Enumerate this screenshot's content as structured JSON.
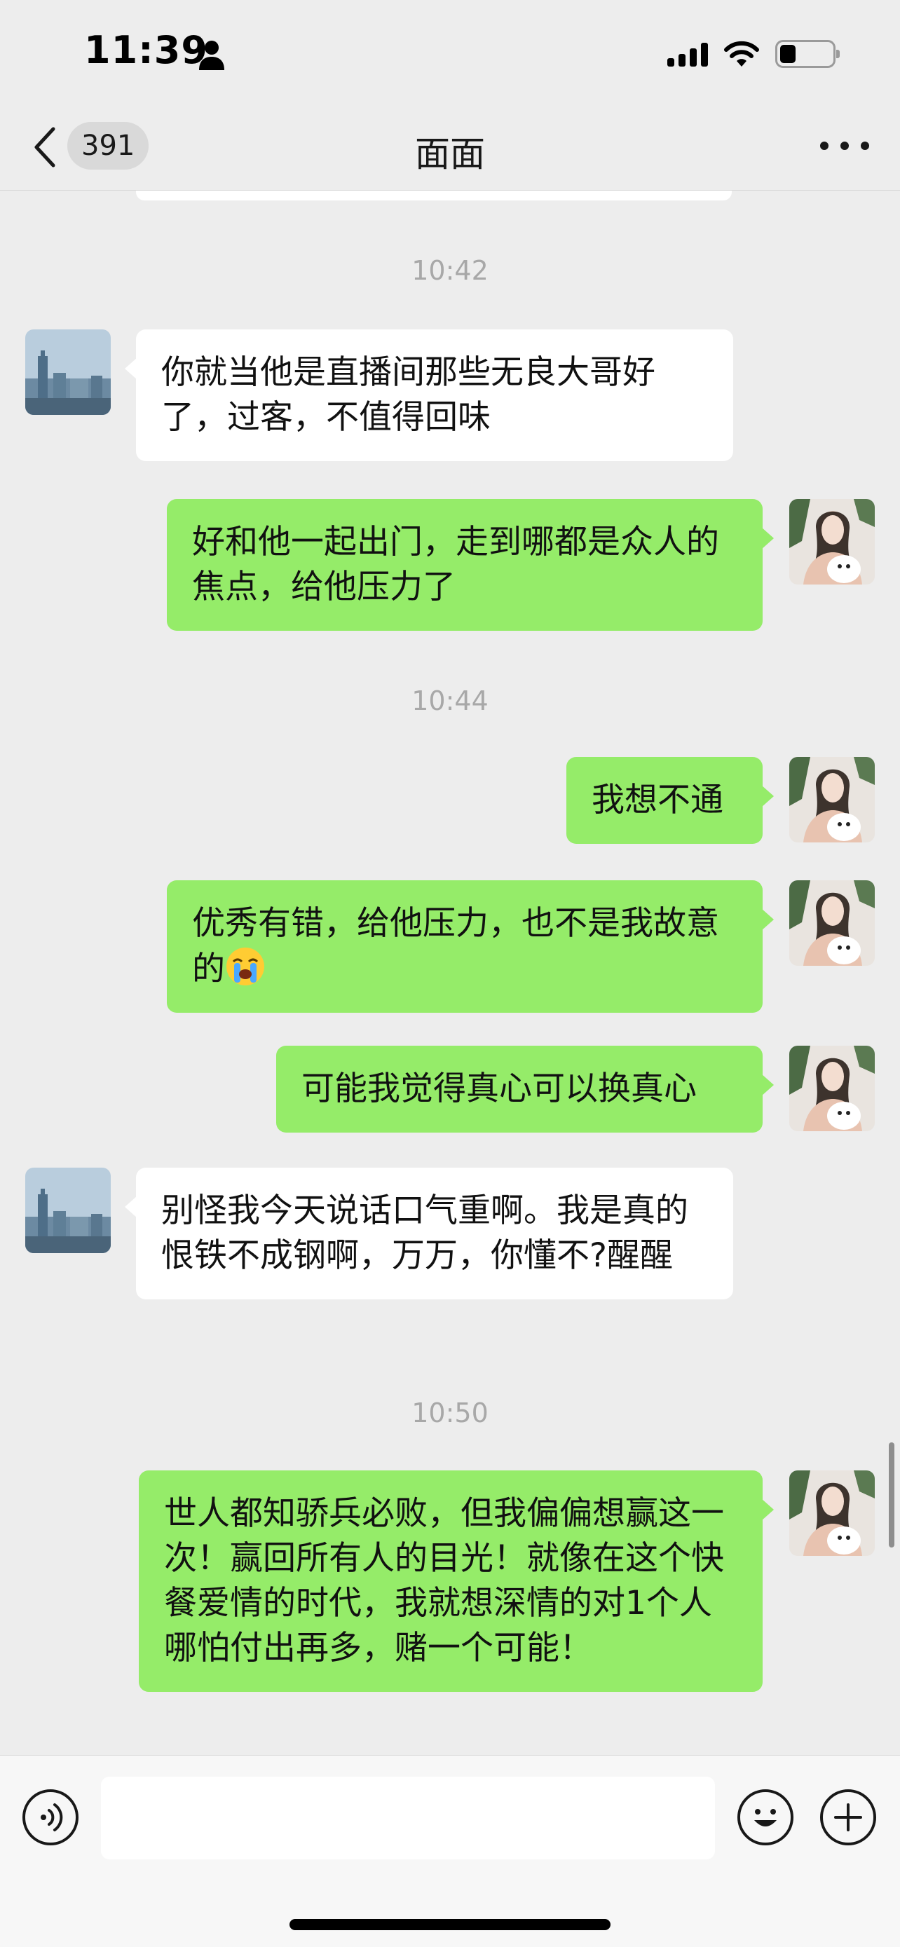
{
  "status_bar": {
    "time": "11:39",
    "person_icon": "person-icon",
    "signal_icon": "cellular-signal-icon",
    "wifi_icon": "wifi-icon",
    "battery_icon": "battery-icon",
    "battery_level": 0.25
  },
  "nav": {
    "back_icon": "chevron-left-icon",
    "unread_count": "391",
    "title": "面面",
    "more_icon": "more-dots-icon"
  },
  "messages": [
    {
      "type": "timestamp",
      "text": "10:42"
    },
    {
      "type": "in",
      "avatar": "city-skyline-avatar",
      "text": "你就当他是直播间那些无良大哥好了，过客，不值得回味"
    },
    {
      "type": "out",
      "avatar": "woman-with-dog-avatar",
      "text": "好和他一起出门，走到哪都是众人的焦点，给他压力了"
    },
    {
      "type": "timestamp",
      "text": "10:44"
    },
    {
      "type": "out",
      "avatar": "woman-with-dog-avatar",
      "text": "我想不通"
    },
    {
      "type": "out",
      "avatar": "woman-with-dog-avatar",
      "text": "优秀有错，给他压力，也不是我故意的",
      "emoji": "loudly-crying-face-icon"
    },
    {
      "type": "out",
      "avatar": "woman-with-dog-avatar",
      "text": "可能我觉得真心可以换真心"
    },
    {
      "type": "in",
      "avatar": "city-skyline-avatar",
      "text": "别怪我今天说话口气重啊。我是真的恨铁不成钢啊，万万，你懂不?醒醒"
    },
    {
      "type": "timestamp",
      "text": "10:50"
    },
    {
      "type": "out",
      "avatar": "woman-with-dog-avatar",
      "text": "世人都知骄兵必败，但我偏偏想赢这一次！赢回所有人的目光！就像在这个快餐爱情的时代，我就想深情的对1个人哪怕付出再多，赌一个可能！"
    }
  ],
  "input_bar": {
    "voice_icon": "voice-input-icon",
    "input_value": "",
    "emoji_icon": "smiley-icon",
    "plus_icon": "plus-icon"
  }
}
